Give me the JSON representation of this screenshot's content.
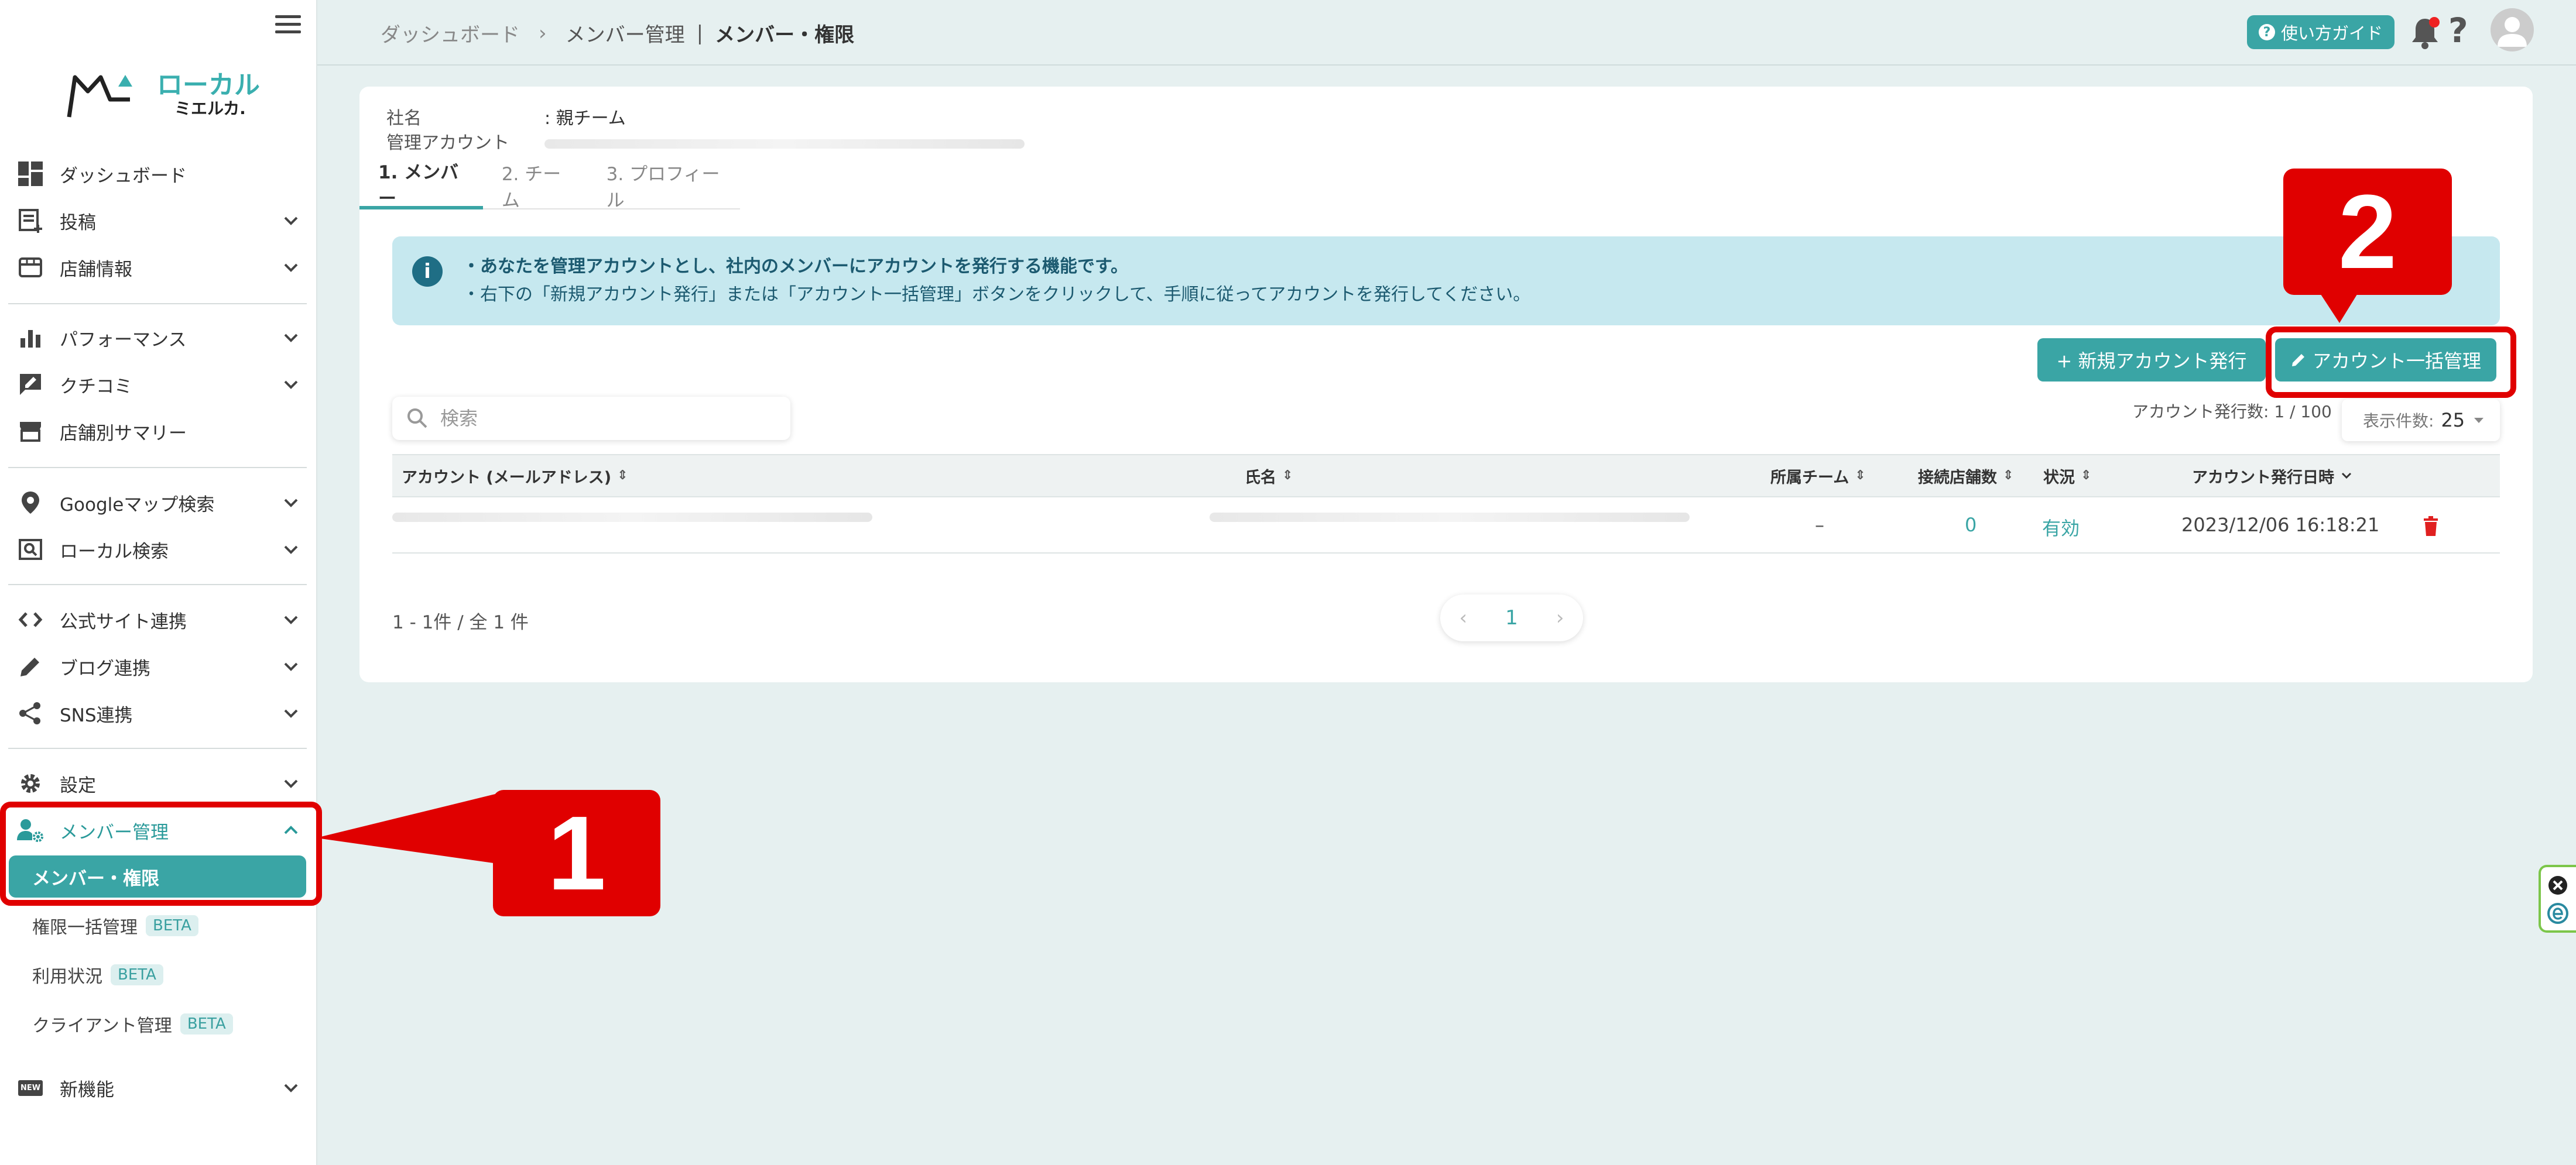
{
  "sidebar": {
    "logo_main": "ローカル",
    "logo_sub": "ミエルカ.",
    "items": [
      {
        "label": "ダッシュボード"
      },
      {
        "label": "投稿"
      },
      {
        "label": "店舗情報"
      },
      {
        "label": "パフォーマンス"
      },
      {
        "label": "クチコミ"
      },
      {
        "label": "店舗別サマリー"
      },
      {
        "label": "Googleマップ検索"
      },
      {
        "label": "ローカル検索"
      },
      {
        "label": "公式サイト連携"
      },
      {
        "label": "ブログ連携"
      },
      {
        "label": "SNS連携"
      },
      {
        "label": "設定"
      },
      {
        "label": "メンバー管理"
      },
      {
        "label": "新機能"
      }
    ],
    "sub_items": [
      {
        "label": "メンバー・権限"
      },
      {
        "label": "権限一括管理",
        "badge": "BETA"
      },
      {
        "label": "利用状況",
        "badge": "BETA"
      },
      {
        "label": "クライアント管理",
        "badge": "BETA"
      }
    ],
    "new_icon_text": "NEW"
  },
  "header": {
    "breadcrumb": [
      "ダッシュボード",
      "メンバー管理",
      "メンバー・権限"
    ],
    "breadcrumb_sep": "›",
    "breadcrumb_pipe": "|",
    "guide_label": "使い方ガイド",
    "guide_icon": "?",
    "help": "?"
  },
  "company": {
    "name_key": "社名",
    "name_value": ": 親チーム",
    "admin_key": "管理アカウント"
  },
  "tabs": [
    {
      "label": "1. メンバー",
      "active": true
    },
    {
      "label": "2. チーム",
      "active": false
    },
    {
      "label": "3. プロフィール",
      "active": false
    }
  ],
  "info": {
    "icon": "i",
    "line1": "・あなたを管理アカウントとし、社内のメンバーにアカウントを発行する機能です。",
    "line2": "・右下の「新規アカウント発行」または「アカウント一括管理」ボタンをクリックして、手順に従ってアカウントを発行してください。"
  },
  "actions": {
    "new_account": "+ 新規アカウント発行",
    "bulk_manage": "アカウント一括管理"
  },
  "search": {
    "placeholder": "検索"
  },
  "account_count": "アカウント発行数: 1 / 100",
  "per_page": {
    "label": "表示件数:",
    "value": "25"
  },
  "table": {
    "columns": [
      "アカウント (メールアドレス)",
      "氏名",
      "所属チーム",
      "接続店舗数",
      "状況",
      "アカウント発行日時"
    ],
    "rows": [
      {
        "team": "–",
        "stores": "0",
        "status": "有効",
        "issued": "2023/12/06 16:18:21"
      }
    ]
  },
  "pagination": {
    "summary": "1 - 1件 / 全 1 件",
    "current": "1",
    "prev": "‹",
    "next": "›"
  },
  "annotations": {
    "badge1": "1",
    "badge2": "2"
  },
  "colors": {
    "accent": "#3aa5a5",
    "annotation": "#e00000",
    "status_active": "#3aa5a5",
    "delete": "#e02020"
  }
}
